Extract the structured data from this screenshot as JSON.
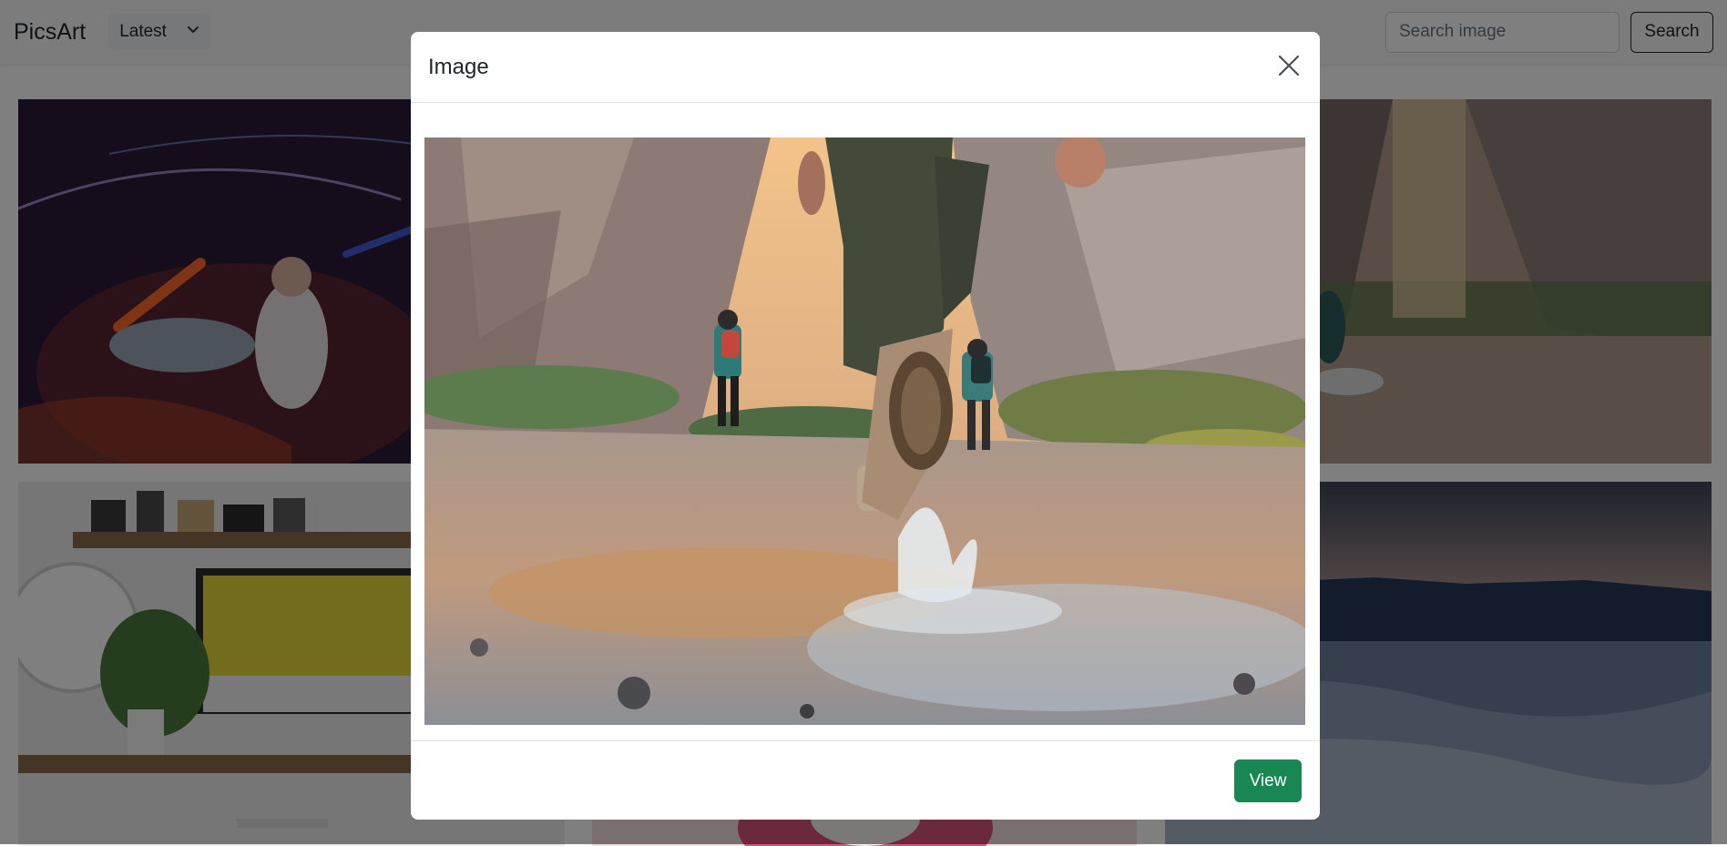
{
  "navbar": {
    "brand": "PicsArt",
    "sort_select": {
      "selected": "Latest"
    },
    "search": {
      "placeholder": "Search image",
      "value": ""
    },
    "search_button_label": "Search"
  },
  "gallery": {
    "tiles": [
      {
        "subject": "dancer with light trails"
      },
      {
        "subject": "hikers walking through canyon"
      },
      {
        "subject": "workspace desk with cameras and monitor"
      },
      {
        "subject": "pink flower"
      },
      {
        "subject": "desert dunes under dusk sky"
      }
    ]
  },
  "modal": {
    "title": "Image",
    "view_button_label": "View",
    "image_subject": "hikers walking through canyon"
  },
  "icons": {
    "sort_select": "chevron-down-icon",
    "modal_close": "close-icon"
  },
  "colors": {
    "view_button": "#198754",
    "navbar_bg": "#f8f9fa",
    "backdrop": "rgba(0,0,0,0.5)"
  }
}
